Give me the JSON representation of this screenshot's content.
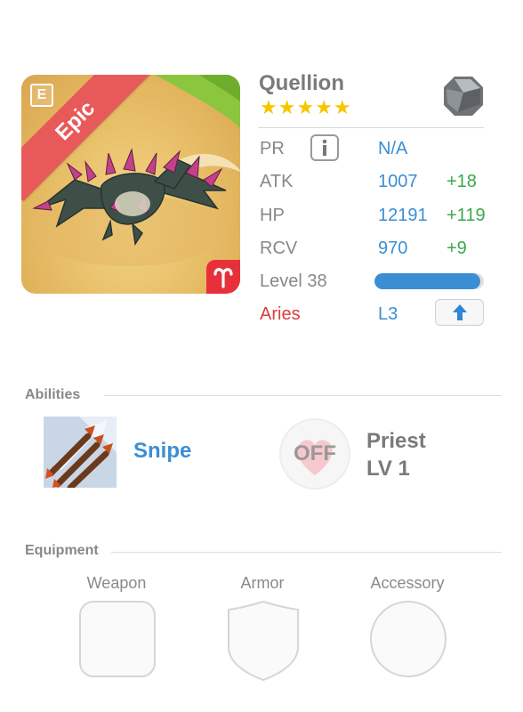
{
  "monster": {
    "name": "Quellion",
    "rarity": "Epic",
    "stars": 5,
    "badge_letter": "E",
    "element_icon": "stone-element-icon"
  },
  "stats": {
    "pr_label": "PR",
    "pr_value": "N/A",
    "atk_label": "ATK",
    "atk_value": "1007",
    "atk_bonus": "+18",
    "hp_label": "HP",
    "hp_value": "12191",
    "hp_bonus": "+119",
    "rcv_label": "RCV",
    "rcv_value": "970",
    "rcv_bonus": "+9",
    "level_label": "Level 38",
    "level_progress": 0.97,
    "sign_label": "Aries",
    "sign_level": "L3"
  },
  "abilities": {
    "title": "Abilities",
    "ability_name": "Snipe",
    "toggle_text": "OFF",
    "class_name": "Priest",
    "class_level": "LV 1"
  },
  "equipment": {
    "title": "Equipment",
    "slots": [
      "Weapon",
      "Armor",
      "Accessory"
    ]
  },
  "colors": {
    "accent_blue": "#3b8ed4",
    "bonus_green": "#3ba84a",
    "sign_red": "#e03a3a",
    "epic_ribbon": "#e8595a",
    "star_gold": "#f7c600"
  }
}
